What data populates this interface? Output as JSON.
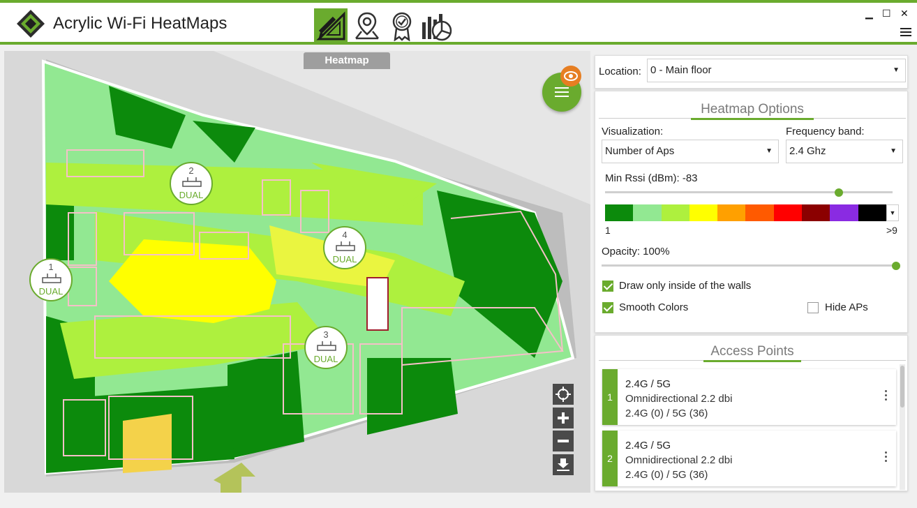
{
  "app": {
    "title": "Acrylic Wi-Fi HeatMaps"
  },
  "toolbar": {
    "tools": [
      {
        "name": "edit-plan-tool",
        "icon": "pencil-ruler-icon",
        "active": true
      },
      {
        "name": "location-tool",
        "icon": "map-pin-icon",
        "active": false
      },
      {
        "name": "certification-tool",
        "icon": "badge-icon",
        "active": false
      },
      {
        "name": "reports-tool",
        "icon": "chart-icon",
        "active": false
      }
    ]
  },
  "window_controls": {
    "minimize": "▁",
    "maximize": "☐",
    "close": "✕"
  },
  "map": {
    "tab_label": "Heatmap",
    "access_points": [
      {
        "number": "1",
        "band": "DUAL"
      },
      {
        "number": "2",
        "band": "DUAL"
      },
      {
        "number": "3",
        "band": "DUAL"
      },
      {
        "number": "4",
        "band": "DUAL"
      }
    ]
  },
  "location": {
    "label": "Location:",
    "value": "0 - Main floor"
  },
  "heatmap_options": {
    "title": "Heatmap Options",
    "visualization_label": "Visualization:",
    "visualization_value": "Number of Aps",
    "frequency_label": "Frequency band:",
    "frequency_value": "2.4 Ghz",
    "min_rssi_label": "Min Rssi (dBm): -83",
    "min_rssi_value": -83,
    "scale_min": "1",
    "scale_max": ">9",
    "scale_colors": [
      "#0c8a0c",
      "#92e892",
      "#aef03e",
      "#ffff00",
      "#ffa000",
      "#ff5a00",
      "#ff0000",
      "#8b0000",
      "#8a2be2",
      "#000000"
    ],
    "opacity_label": "Opacity: 100%",
    "opacity_value": 100,
    "draw_inside_walls_label": "Draw only inside of the walls",
    "draw_inside_walls": true,
    "smooth_colors_label": "Smooth Colors",
    "smooth_colors": true,
    "hide_aps_label": "Hide APs",
    "hide_aps": false
  },
  "access_points_section": {
    "title": "Access Points",
    "items": [
      {
        "number": "1",
        "bands": "2.4G / 5G",
        "antenna": "Omnidirectional 2.2 dbi",
        "channels": "2.4G (0) / 5G (36)"
      },
      {
        "number": "2",
        "bands": "2.4G / 5G",
        "antenna": "Omnidirectional 2.2 dbi",
        "channels": "2.4G (0) / 5G (36)"
      }
    ]
  },
  "colors": {
    "accent": "#6aab2e",
    "orange": "#e67e22"
  }
}
